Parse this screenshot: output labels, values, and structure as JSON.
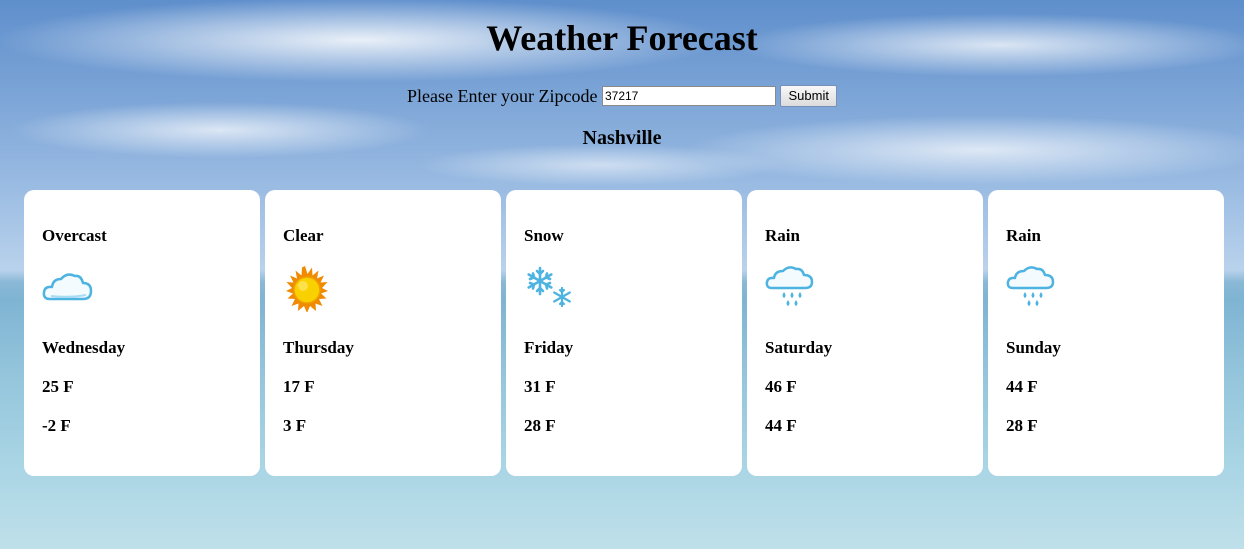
{
  "header": {
    "title": "Weather Forecast"
  },
  "zip_form": {
    "label": "Please Enter your Zipcode",
    "value": "37217",
    "submit_label": "Submit"
  },
  "city": "Nashville",
  "forecast": [
    {
      "condition": "Overcast",
      "icon": "cloud-icon",
      "day": "Wednesday",
      "high": "25 F",
      "low": "-2 F"
    },
    {
      "condition": "Clear",
      "icon": "sun-icon",
      "day": "Thursday",
      "high": "17 F",
      "low": "3 F"
    },
    {
      "condition": "Snow",
      "icon": "snowflake-icon",
      "day": "Friday",
      "high": "31 F",
      "low": "28 F"
    },
    {
      "condition": "Rain",
      "icon": "rain-cloud-icon",
      "day": "Saturday",
      "high": "46 F",
      "low": "44 F"
    },
    {
      "condition": "Rain",
      "icon": "rain-cloud-icon",
      "day": "Sunday",
      "high": "44 F",
      "low": "28 F"
    }
  ],
  "colors": {
    "card_background": "#ffffff",
    "icon_blue": "#4db3e0",
    "sun_yellow": "#f5c400",
    "sun_orange": "#f08a00"
  }
}
